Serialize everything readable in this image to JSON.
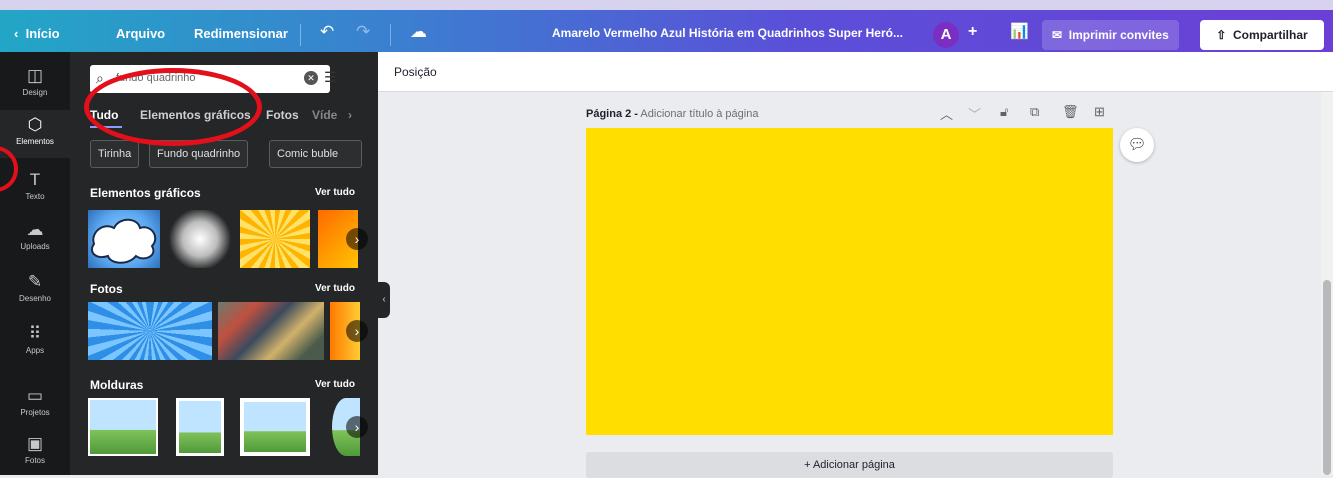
{
  "topbar": {
    "back_label": "Início",
    "file_label": "Arquivo",
    "resize_label": "Redimensionar",
    "undo_icon": "undo-icon",
    "redo_icon": "redo-icon",
    "cloud_icon": "cloud-save-icon",
    "doc_title": "Amarelo Vermelho Azul História em Quadrinhos Super Heró...",
    "avatar_initial": "A",
    "add_symbol": "+",
    "print_label": "Imprimir convites",
    "share_label": "Compartilhar"
  },
  "rail": {
    "items": [
      {
        "label": "Design",
        "icon": "layout-icon"
      },
      {
        "label": "Elementos",
        "icon": "elements-icon"
      },
      {
        "label": "Texto",
        "icon": "text-icon"
      },
      {
        "label": "Uploads",
        "icon": "cloud-upload-icon"
      },
      {
        "label": "Desenho",
        "icon": "draw-icon"
      },
      {
        "label": "Apps",
        "icon": "apps-grid-icon"
      },
      {
        "label": "Projetos",
        "icon": "folder-icon"
      },
      {
        "label": "Fotos",
        "icon": "photo-icon"
      }
    ]
  },
  "panel": {
    "search_value": "fundo quadrinho",
    "tabs": [
      "Tudo",
      "Elementos gráficos",
      "Fotos",
      "Víde"
    ],
    "chips": [
      "Tirinha",
      "Fundo quadrinho",
      "Comic buble"
    ],
    "sections": [
      {
        "title": "Elementos gráficos",
        "link": "Ver tudo"
      },
      {
        "title": "Fotos",
        "link": "Ver tudo"
      },
      {
        "title": "Molduras",
        "link": "Ver tudo"
      }
    ]
  },
  "canvas": {
    "position_label": "Posição",
    "page_title": "Página 2 -",
    "page_subtitle": "Adicionar título à página",
    "add_page_label": "+ Adicionar página",
    "page_color": "#ffde00"
  },
  "colors": {
    "annotation_red": "#e3101b",
    "panel_bg": "#252627",
    "rail_bg": "#18191b"
  }
}
